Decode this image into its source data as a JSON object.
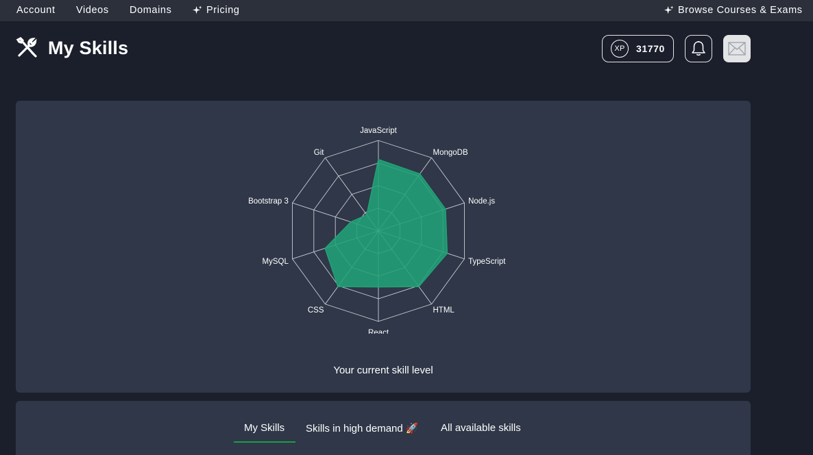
{
  "nav": {
    "account": "Account",
    "videos": "Videos",
    "domains": "Domains",
    "pricing": "Pricing",
    "browse": "Browse Courses & Exams"
  },
  "header": {
    "title": "My Skills",
    "xp_label": "XP",
    "xp_value": "31770"
  },
  "icons": {
    "title": "tools-icon",
    "xp": "xp-badge-icon",
    "notifications": "bell-icon",
    "messages": "envelope-icon",
    "pricing": "sparkle-icon",
    "browse": "sparkle-icon"
  },
  "colors": {
    "accent_fill": "#21a276",
    "tab_active": "#1a9e45",
    "panel_bg": "#2f3748",
    "page_bg": "#1b1f2b"
  },
  "chart_data": {
    "type": "radar",
    "caption": "Your current skill level",
    "axes": [
      "JavaScript",
      "MongoDB",
      "Node.js",
      "TypeScript",
      "HTML",
      "React",
      "CSS",
      "MySQL",
      "Bootstrap 3",
      "Git"
    ],
    "rings": 4,
    "range": [
      0,
      100
    ],
    "values": [
      79,
      78,
      78,
      80,
      76,
      62,
      76,
      62,
      32,
      22
    ]
  },
  "tabs": {
    "my_skills": "My Skills",
    "high_demand": "Skills in high demand 🚀",
    "all": "All available skills",
    "active": "My Skills"
  }
}
